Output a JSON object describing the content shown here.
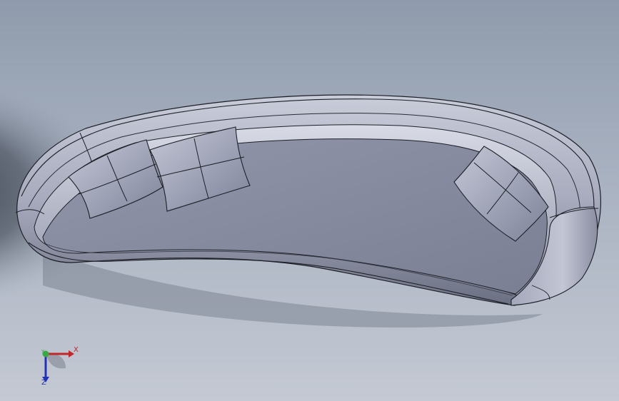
{
  "viewport": {
    "background_top": "#8f9bac",
    "background_bottom": "#c4c9d3",
    "model": "curved-sofa-with-cushions"
  },
  "triad": {
    "x_label": "X",
    "y_label": "Y",
    "z_label": "Z",
    "x_color": "#c0262a",
    "y_color": "#3aa845",
    "z_color": "#2332b5"
  }
}
